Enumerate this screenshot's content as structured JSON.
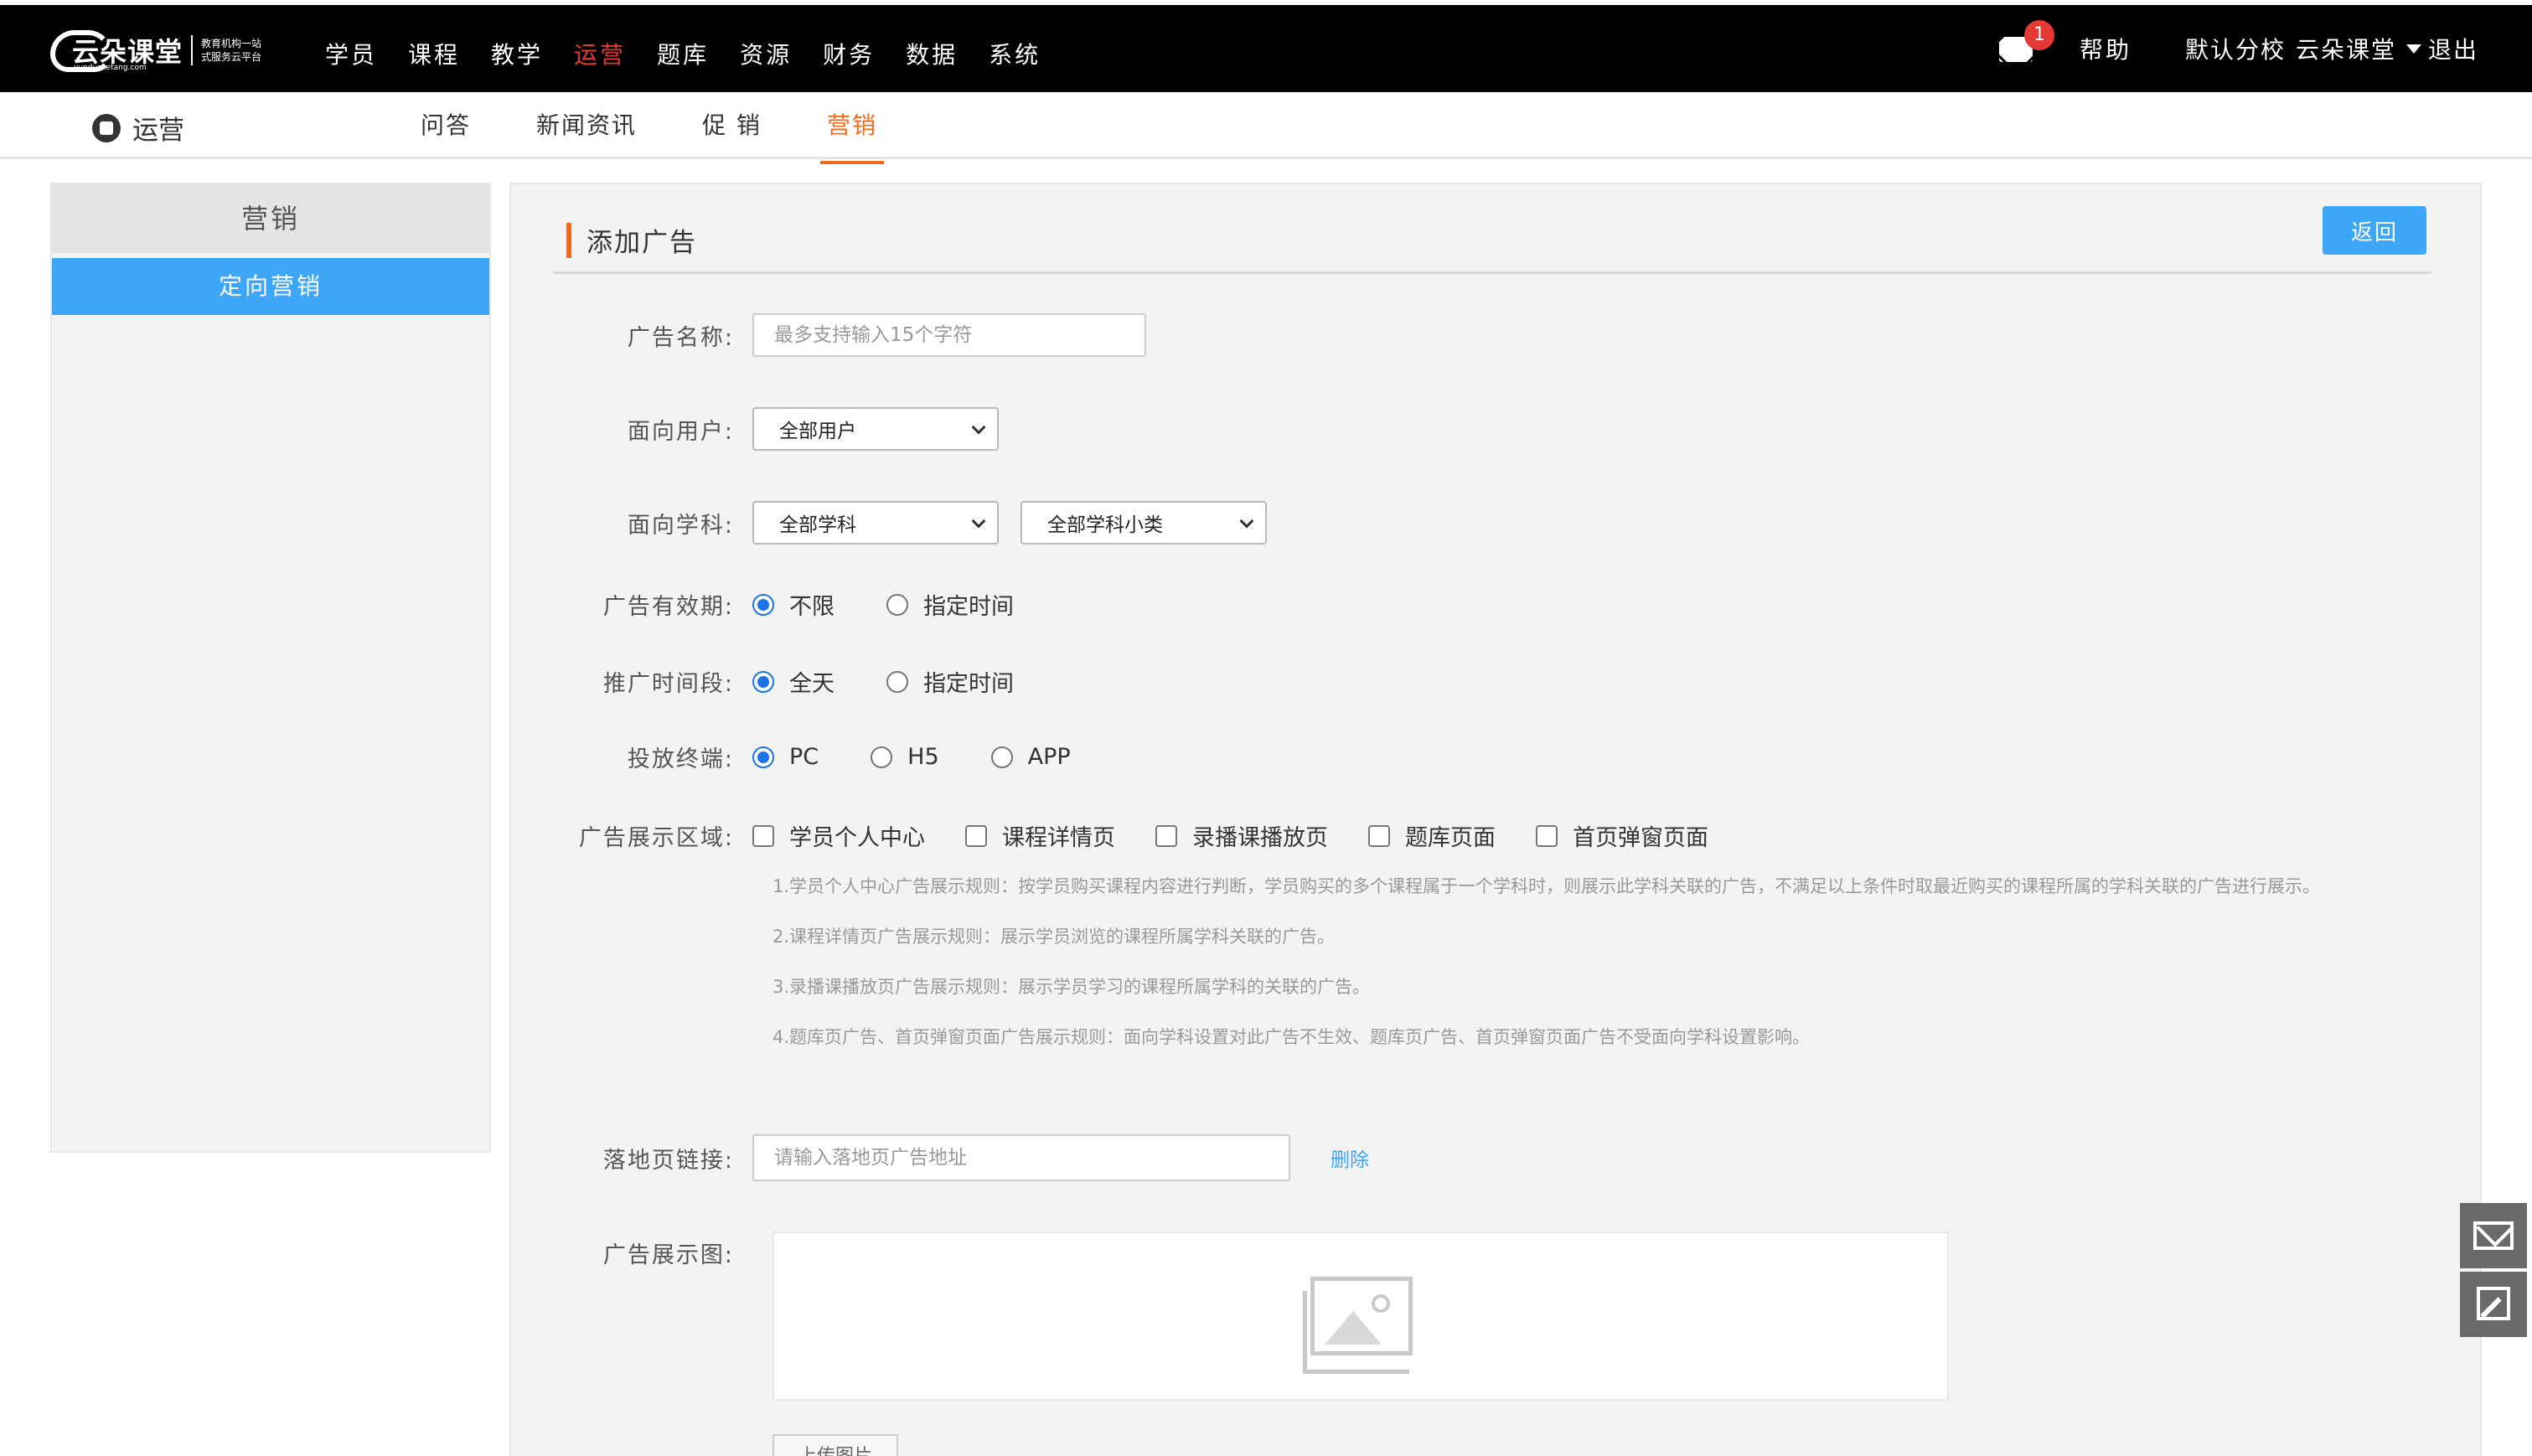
{
  "brand": {
    "name": "云朵课堂",
    "tagline": "教育机构一站式服务云平台",
    "domain": "yunduoketang.com"
  },
  "nav": {
    "items": [
      "学员",
      "课程",
      "教学",
      "运营",
      "题库",
      "资源",
      "财务",
      "数据",
      "系统"
    ],
    "active_index": 3
  },
  "header_right": {
    "message_count": "1",
    "help": "帮助",
    "school": "默认分校",
    "user": "云朵课堂",
    "logout": "退出"
  },
  "subnav": {
    "section": "运营",
    "tabs": [
      "问答",
      "新闻资讯",
      "促 销",
      "营销"
    ],
    "active_index": 3
  },
  "sidebar": {
    "header": "营销",
    "items": [
      {
        "label": "定向营销",
        "active": true
      }
    ]
  },
  "form": {
    "title": "添加广告",
    "back_label": "返回",
    "ad_name": {
      "label": "广告名称:",
      "placeholder": "最多支持输入15个字符"
    },
    "audience": {
      "label": "面向用户:",
      "value": "全部用户"
    },
    "subject": {
      "label": "面向学科:",
      "value": "全部学科",
      "sub_value": "全部学科小类"
    },
    "validity": {
      "label": "广告有效期:",
      "options": [
        "不限",
        "指定时间"
      ],
      "selected": 0
    },
    "time_slot": {
      "label": "推广时间段:",
      "options": [
        "全天",
        "指定时间"
      ],
      "selected": 0
    },
    "terminal": {
      "label": "投放终端:",
      "options": [
        "PC",
        "H5",
        "APP"
      ],
      "selected": 0
    },
    "display_area": {
      "label": "广告展示区域:",
      "options": [
        "学员个人中心",
        "课程详情页",
        "录播课播放页",
        "题库页面",
        "首页弹窗页面"
      ]
    },
    "rules": [
      "1.学员个人中心广告展示规则：按学员购买课程内容进行判断，学员购买的多个课程属于一个学科时，则展示此学科关联的广告，不满足以上条件时取最近购买的课程所属的学科关联的广告进行展示。",
      "2.课程详情页广告展示规则：展示学员浏览的课程所属学科关联的广告。",
      "3.录播课播放页广告展示规则：展示学员学习的课程所属学科的关联的广告。",
      "4.题库页广告、首页弹窗页面广告展示规则：面向学科设置对此广告不生效、题库页广告、首页弹窗页面广告不受面向学科设置影响。"
    ],
    "landing": {
      "label": "落地页链接:",
      "placeholder": "请输入落地页广告地址",
      "delete_label": "删除"
    },
    "image": {
      "label": "广告展示图:",
      "upload_label": "上传图片"
    }
  },
  "colors": {
    "accent_orange": "#f26b1d",
    "accent_blue": "#3ea6f6",
    "nav_active_red": "#e53935"
  }
}
